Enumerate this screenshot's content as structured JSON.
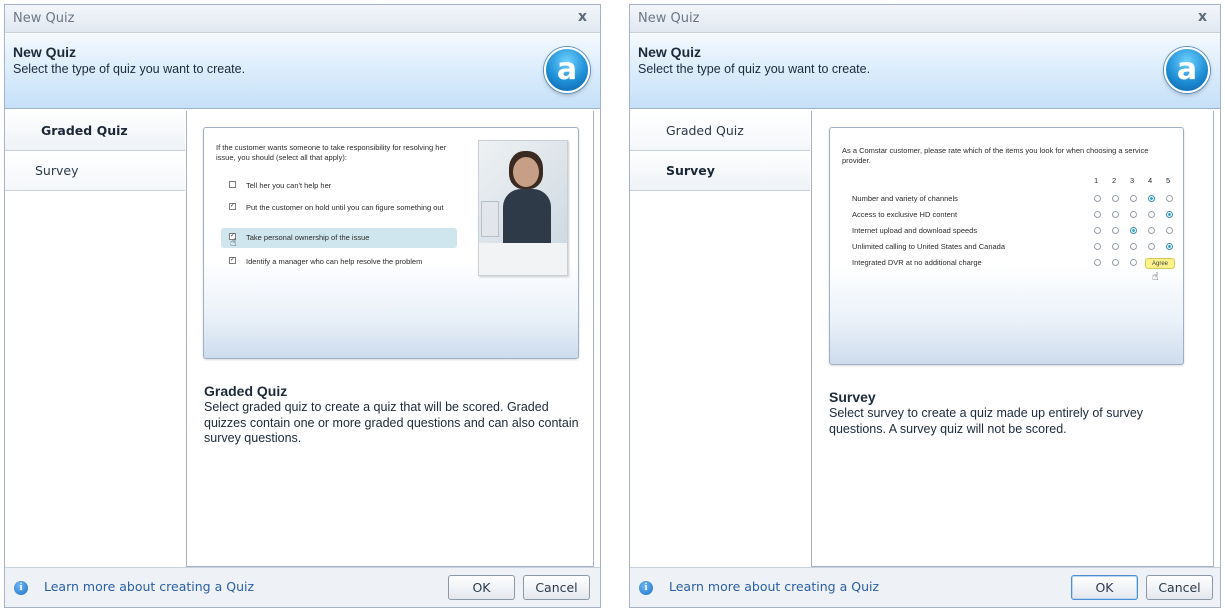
{
  "dialogs": {
    "left": {
      "window_title": "New Quiz",
      "close": "x",
      "header_title": "New Quiz",
      "header_subtitle": "Select the type of quiz you want to create.",
      "logo": "a",
      "nav": [
        "Graded Quiz",
        "Survey"
      ],
      "active_nav": "Graded Quiz",
      "preview": {
        "question": "If the customer wants someone to take responsibility for resolving her issue, you should (select all that apply):",
        "options": [
          {
            "text": "Tell her you can't help her",
            "checked": false
          },
          {
            "text": "Put the customer on hold until you can figure something out",
            "checked": true
          },
          {
            "text": "Take personal ownership of the issue",
            "checked": true,
            "highlighted": true
          },
          {
            "text": "Identify a manager who can help resolve the problem",
            "checked": true
          }
        ]
      },
      "desc_title": "Graded Quiz",
      "desc_text": "Select graded quiz to create a quiz that will be scored. Graded quizzes contain one or more graded questions and can also contain survey questions.",
      "learn_more": "Learn more about creating a Quiz",
      "ok": "OK",
      "cancel": "Cancel"
    },
    "right": {
      "window_title": "New Quiz",
      "close": "x",
      "header_title": "New Quiz",
      "header_subtitle": "Select the type of quiz you want to create.",
      "logo": "a",
      "nav": [
        "Graded Quiz",
        "Survey"
      ],
      "active_nav": "Survey",
      "preview": {
        "question": "As a Comstar customer, please rate which of the items you look for when choosing a service provider.",
        "scale": [
          "1",
          "2",
          "3",
          "4",
          "5"
        ],
        "rows": [
          {
            "label": "Number and variety of channels",
            "selected": 4
          },
          {
            "label": "Access to exclusive HD content",
            "selected": 5
          },
          {
            "label": "Internet upload and download speeds",
            "selected": 3
          },
          {
            "label": "Unlimited calling to United States and Canada",
            "selected": 5
          },
          {
            "label": "Integrated DVR at no additional charge",
            "selected": 4
          }
        ],
        "tooltip": "Agree"
      },
      "desc_title": "Survey",
      "desc_text": "Select survey to create a quiz made up entirely of survey questions.  A survey quiz will not be scored.",
      "learn_more": "Learn more about creating a Quiz",
      "ok": "OK",
      "cancel": "Cancel"
    }
  }
}
